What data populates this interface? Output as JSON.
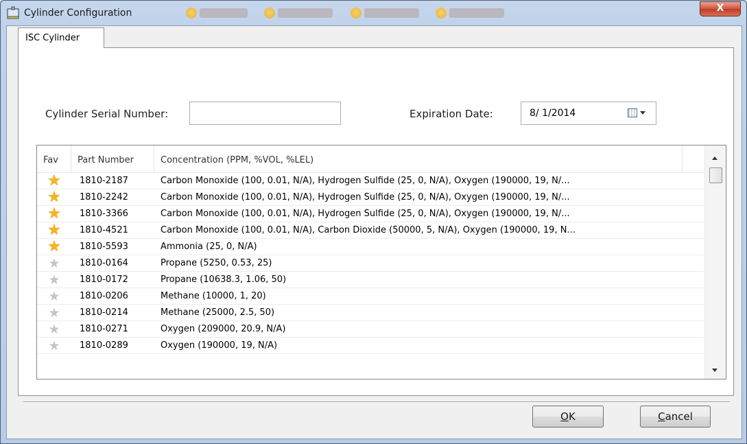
{
  "window": {
    "title": "Cylinder Configuration",
    "close_glyph": "X"
  },
  "tabs": [
    {
      "label": "ISC Cylinder",
      "selected": true
    }
  ],
  "form": {
    "serial_label": "Cylinder Serial Number:",
    "serial_value": "",
    "expiration_label": "Expiration Date:",
    "expiration_value": "8/ 1/2014"
  },
  "grid": {
    "columns": [
      "Fav",
      "Part Number",
      "Concentration (PPM, %VOL, %LEL)"
    ],
    "rows": [
      {
        "fav": true,
        "part": "1810-2187",
        "conc": "Carbon Monoxide (100, 0.01, N/A), Hydrogen Sulfide (25, 0, N/A), Oxygen (190000, 19, N/..."
      },
      {
        "fav": true,
        "part": "1810-2242",
        "conc": "Carbon Monoxide (100, 0.01, N/A), Hydrogen Sulfide (25, 0, N/A), Oxygen (190000, 19, N/..."
      },
      {
        "fav": true,
        "part": "1810-3366",
        "conc": "Carbon Monoxide (100, 0.01, N/A), Hydrogen Sulfide (25, 0, N/A), Oxygen (190000, 19, N/..."
      },
      {
        "fav": true,
        "part": "1810-4521",
        "conc": "Carbon Monoxide (100, 0.01, N/A), Carbon Dioxide (50000, 5, N/A), Oxygen (190000, 19, N..."
      },
      {
        "fav": true,
        "part": "1810-5593",
        "conc": "Ammonia (25, 0, N/A)"
      },
      {
        "fav": false,
        "part": "1810-0164",
        "conc": "Propane (5250, 0.53, 25)"
      },
      {
        "fav": false,
        "part": "1810-0172",
        "conc": "Propane (10638.3, 1.06, 50)"
      },
      {
        "fav": false,
        "part": "1810-0206",
        "conc": "Methane (10000, 1, 20)"
      },
      {
        "fav": false,
        "part": "1810-0214",
        "conc": "Methane (25000, 2.5, 50)"
      },
      {
        "fav": false,
        "part": "1810-0271",
        "conc": "Oxygen (209000, 20.9, N/A)"
      },
      {
        "fav": false,
        "part": "1810-0289",
        "conc": "Oxygen (190000, 19, N/A)"
      }
    ]
  },
  "buttons": {
    "ok_label": "OK",
    "ok_mnemonic": "O",
    "ok_rest": "K",
    "cancel_label": "Cancel",
    "cancel_mnemonic": "C",
    "cancel_rest": "ancel"
  },
  "icons": {
    "fav_on": "star-filled-icon",
    "fav_off": "star-outline-icon"
  },
  "colors": {
    "star_gold": "#f5b51c",
    "star_grey": "#c5c5c5",
    "close_red": "#c23a22"
  }
}
